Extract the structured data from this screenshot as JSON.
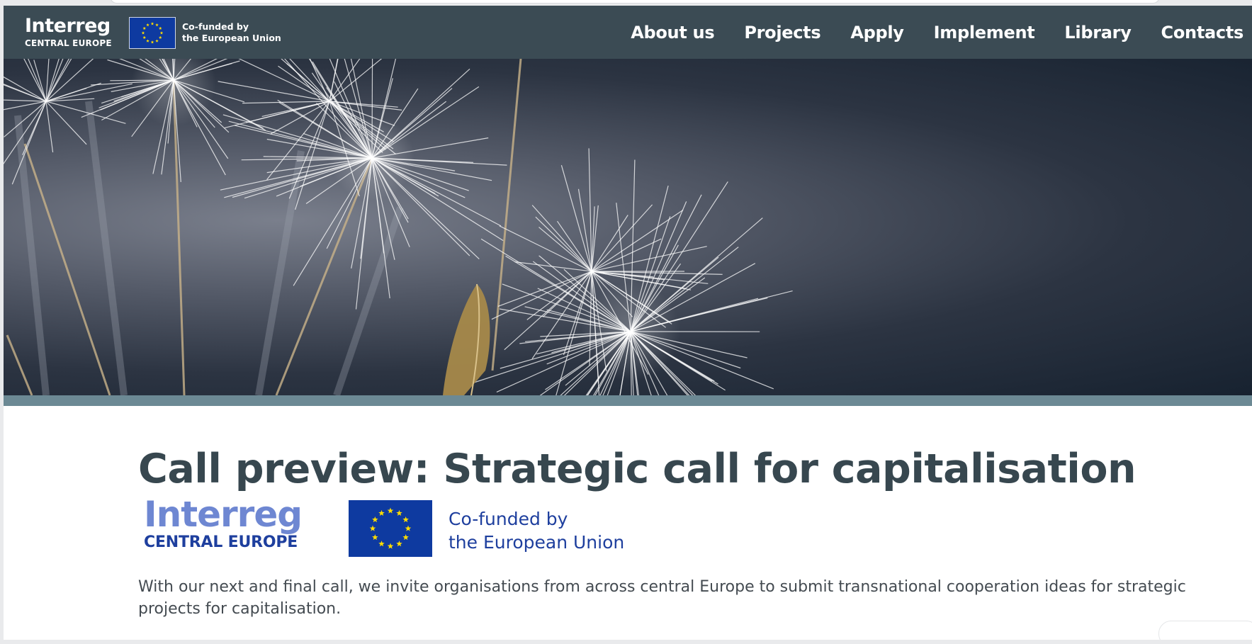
{
  "header": {
    "brand": {
      "title": "Interreg",
      "subtitle": "CENTRAL EUROPE"
    },
    "cofunded": {
      "line1": "Co-funded by",
      "line2": "the European Union"
    },
    "nav": [
      {
        "label": "About us"
      },
      {
        "label": "Projects"
      },
      {
        "label": "Apply"
      },
      {
        "label": "Implement"
      },
      {
        "label": "Library"
      },
      {
        "label": "Contacts"
      }
    ]
  },
  "hero": {
    "image": "dandelion-seeds-photo"
  },
  "main": {
    "title": "Call preview: Strategic call for capitalisation",
    "logo": {
      "title": "Interreg",
      "subtitle": "CENTRAL EUROPE",
      "cofunded_line1": "Co-funded by",
      "cofunded_line2": "the European Union"
    },
    "intro": "With our next and final call, we invite organisations from across central Europe to submit transnational cooperation ideas for strategic projects for capitalisation."
  },
  "colors": {
    "header_bg": "#3b4b54",
    "hero_bar": "#6c8994",
    "title_text": "#37474f",
    "eu_blue": "#0e3aa0",
    "eu_star": "#ffdd00"
  }
}
